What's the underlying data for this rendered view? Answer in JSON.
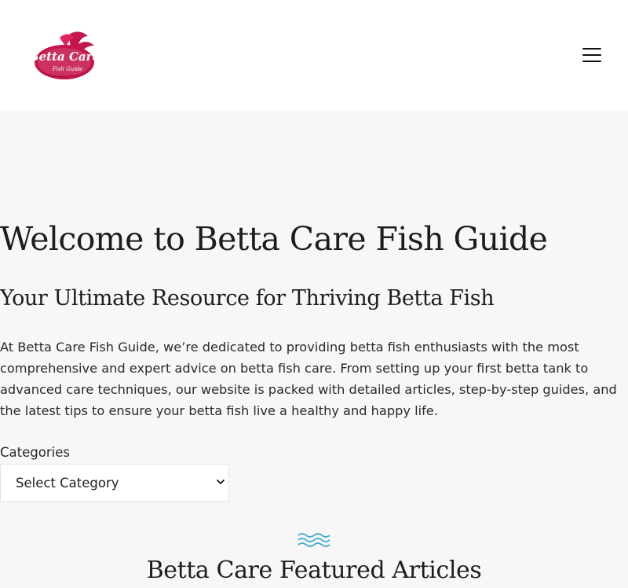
{
  "header": {
    "logo": {
      "line1": "Betta Care",
      "line2": "Fish Guide",
      "colors": {
        "primary": "#c4164a",
        "dark": "#7a0f2e"
      }
    },
    "menu_icon": "hamburger-menu-icon"
  },
  "hero": {
    "title": "Welcome to Betta Care Fish Guide",
    "subtitle": "Your Ultimate Resource for Thriving Betta Fish",
    "intro": "At Betta Care Fish Guide, we’re dedicated to providing betta fish enthusiasts with the most comprehensive and expert advice on betta fish care. From setting up your first betta tank to advanced care techniques, our website is packed with detailed articles, step-by-step guides, and the latest tips to ensure your betta fish live a healthy and happy life."
  },
  "categories": {
    "label": "Categories",
    "selected": "Select Category"
  },
  "featured": {
    "icon": "waves-icon",
    "icon_color": "#3fa9c9",
    "heading": "Betta Care Featured Articles"
  }
}
